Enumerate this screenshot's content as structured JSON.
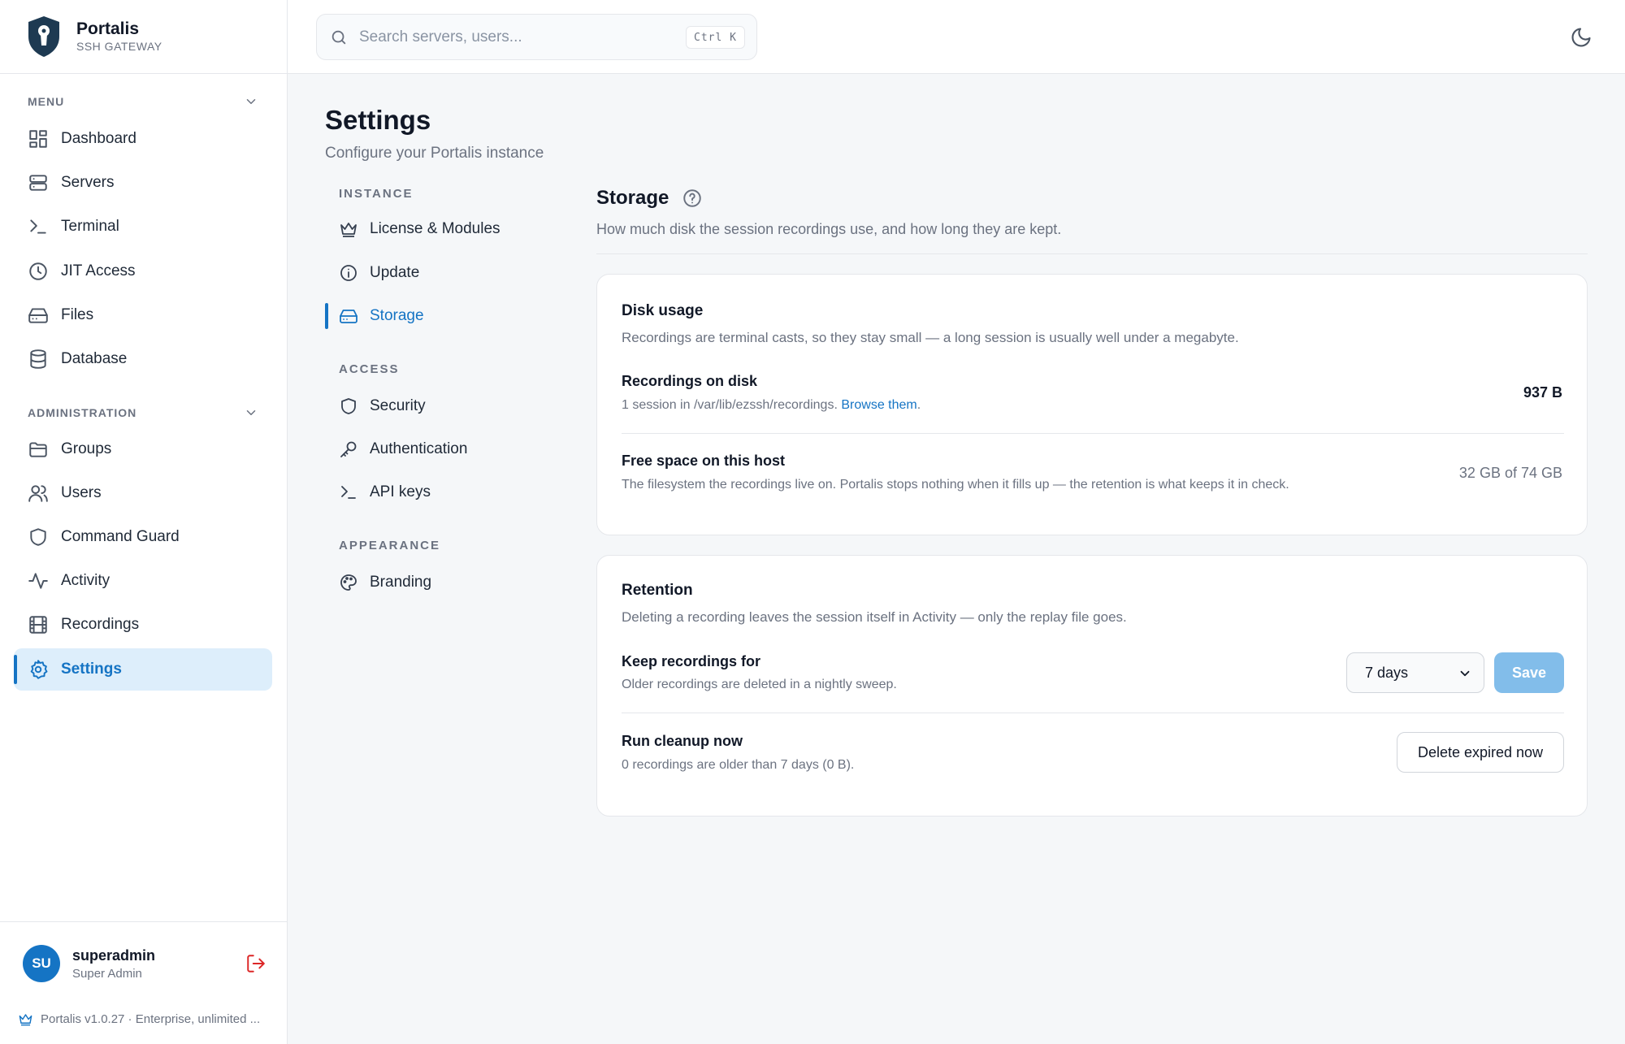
{
  "brand": {
    "name": "Portalis",
    "subtitle": "SSH GATEWAY"
  },
  "sidebar": {
    "menu_heading": "MENU",
    "menu_items": [
      {
        "label": "Dashboard",
        "icon": "grid-icon"
      },
      {
        "label": "Servers",
        "icon": "server-icon"
      },
      {
        "label": "Terminal",
        "icon": "terminal-icon"
      },
      {
        "label": "JIT Access",
        "icon": "clock-icon"
      },
      {
        "label": "Files",
        "icon": "drive-icon"
      },
      {
        "label": "Database",
        "icon": "database-icon"
      }
    ],
    "admin_heading": "ADMINISTRATION",
    "admin_items": [
      {
        "label": "Groups",
        "icon": "folder-icon"
      },
      {
        "label": "Users",
        "icon": "users-icon"
      },
      {
        "label": "Command Guard",
        "icon": "shield-icon"
      },
      {
        "label": "Activity",
        "icon": "activity-icon"
      },
      {
        "label": "Recordings",
        "icon": "film-icon"
      },
      {
        "label": "Settings",
        "icon": "gear-icon",
        "active": true
      }
    ]
  },
  "user": {
    "initials": "SU",
    "name": "superadmin",
    "role": "Super Admin"
  },
  "footer": {
    "version": "Portalis v1.0.27 · Enterprise, unlimited ..."
  },
  "search": {
    "placeholder": "Search servers, users...",
    "shortcut": "Ctrl K"
  },
  "page": {
    "title": "Settings",
    "subtitle": "Configure your Portalis instance"
  },
  "settings_nav": {
    "instance_heading": "INSTANCE",
    "instance_items": [
      {
        "label": "License & Modules",
        "icon": "crown-icon"
      },
      {
        "label": "Update",
        "icon": "info-icon"
      },
      {
        "label": "Storage",
        "icon": "drive-icon",
        "active": true
      }
    ],
    "access_heading": "ACCESS",
    "access_items": [
      {
        "label": "Security",
        "icon": "shield-icon"
      },
      {
        "label": "Authentication",
        "icon": "key-icon"
      },
      {
        "label": "API keys",
        "icon": "terminal-icon"
      }
    ],
    "appearance_heading": "APPEARANCE",
    "appearance_items": [
      {
        "label": "Branding",
        "icon": "palette-icon"
      }
    ]
  },
  "storage": {
    "title": "Storage",
    "description": "How much disk the session recordings use, and how long they are kept.",
    "disk_usage": {
      "title": "Disk usage",
      "description": "Recordings are terminal casts, so they stay small — a long session is usually well under a megabyte.",
      "recordings_label": "Recordings on disk",
      "recordings_desc": "1 session in /var/lib/ezssh/recordings.",
      "recordings_link": "Browse them",
      "recordings_link_suffix": ".",
      "recordings_value": "937 B",
      "free_label": "Free space on this host",
      "free_desc": "The filesystem the recordings live on. Portalis stops nothing when it fills up — the retention is what keeps it in check.",
      "free_value": "32 GB of 74 GB"
    },
    "retention": {
      "title": "Retention",
      "description": "Deleting a recording leaves the session itself in Activity — only the replay file goes.",
      "keep_label": "Keep recordings for",
      "keep_desc": "Older recordings are deleted in a nightly sweep.",
      "keep_value": "7 days",
      "save_label": "Save",
      "cleanup_label": "Run cleanup now",
      "cleanup_desc": "0 recordings are older than 7 days (0 B).",
      "cleanup_button": "Delete expired now"
    }
  },
  "colors": {
    "accent": "#1574c4",
    "accent_soft": "#ddeefb",
    "danger": "#dc2626"
  }
}
